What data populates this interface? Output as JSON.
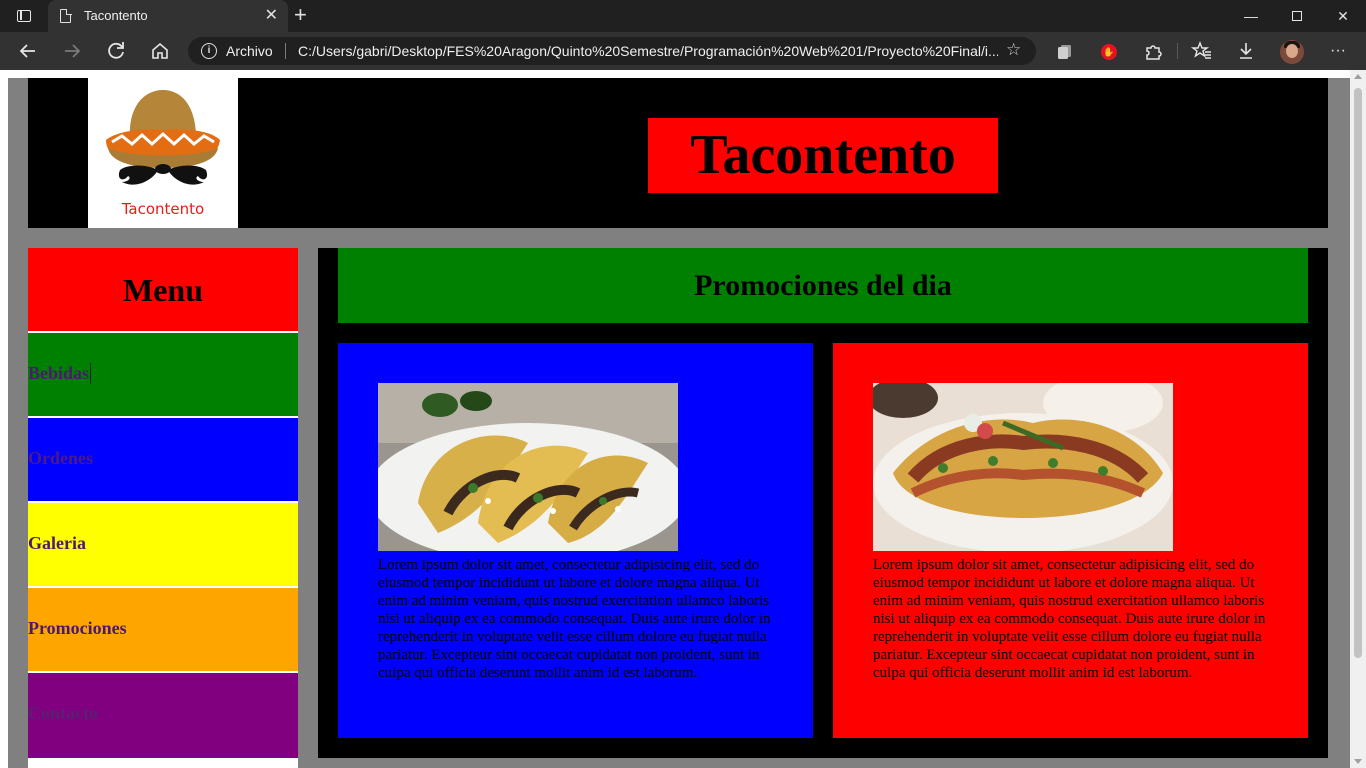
{
  "browser": {
    "tab_title": "Tacontento",
    "tab_close": "✕",
    "new_tab": "+",
    "address_label": "Archivo",
    "url": "C:/Users/gabri/Desktop/FES%20Aragon/Quinto%20Semestre/Programación%20Web%201/Proyecto%20Final/i...",
    "window_min": "—",
    "window_close": "✕"
  },
  "header": {
    "logo_text": "Tacontento",
    "site_title": "Tacontento"
  },
  "menu": {
    "title": "Menu",
    "items": [
      {
        "label": "Bebidas",
        "bg": "#008000"
      },
      {
        "label": "Ordenes",
        "bg": "#0000ff"
      },
      {
        "label": "Galeria",
        "bg": "#ffff00"
      },
      {
        "label": "Promociones",
        "bg": "#ffa500"
      },
      {
        "label": "Contacto",
        "bg": "#800080"
      }
    ]
  },
  "main": {
    "title": "Promociones del dia",
    "cards": [
      {
        "bg": "#0000ff",
        "text": "Lorem ipsum dolor sit amet, consectetur adipisicing elit, sed do eiusmod tempor incididunt ut labore et dolore magna aliqua. Ut enim ad minim veniam, quis nostrud exercitation ullamco laboris nisi ut aliquip ex ea commodo consequat. Duis aute irure dolor in reprehenderit in voluptate velit esse cillum dolore eu fugiat nulla pariatur. Excepteur sint occaecat cupidatat non proident, sunt in culpa qui officia deserunt mollit anim id est laborum."
      },
      {
        "bg": "#ff0000",
        "text": "Lorem ipsum dolor sit amet, consectetur adipisicing elit, sed do eiusmod tempor incididunt ut labore et dolore magna aliqua. Ut enim ad minim veniam, quis nostrud exercitation ullamco laboris nisi ut aliquip ex ea commodo consequat. Duis aute irure dolor in reprehenderit in voluptate velit esse cillum dolore eu fugiat nulla pariatur. Excepteur sint occaecat cupidatat non proident, sunt in culpa qui officia deserunt mollit anim id est laborum."
      }
    ]
  },
  "icons": [
    "tab-actions-icon",
    "document-icon",
    "back-arrow-icon",
    "forward-arrow-icon",
    "reload-icon",
    "home-icon",
    "info-icon",
    "add-favorite-icon",
    "collections-icon",
    "adblock-icon",
    "extensions-icon",
    "favorites-icon",
    "download-icon",
    "profile-avatar",
    "more-icon",
    "sombrero-logo-icon"
  ]
}
